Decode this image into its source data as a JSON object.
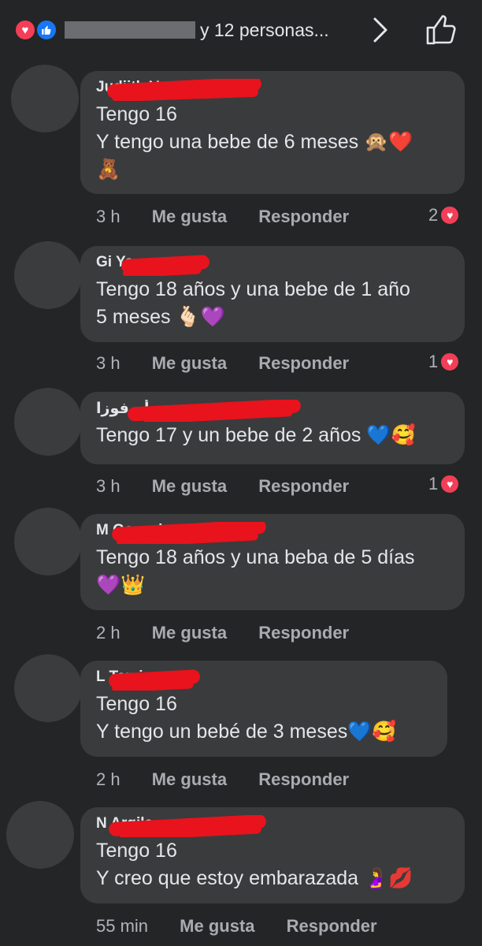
{
  "header": {
    "reactors_text": "y 12 personas...",
    "love_icon": "heart-icon",
    "like_icon": "thumbs-up-icon"
  },
  "comments": [
    {
      "author": "Judiith Vasquez",
      "lines": [
        "Tengo 16",
        "Y tengo una bebe de 6 meses 🙊❤️",
        "🧸"
      ],
      "time": "3 h",
      "like": "Me gusta",
      "reply": "Responder",
      "reactions": "2"
    },
    {
      "author": "Gi Ya",
      "lines": [
        "Tengo 18 años y una bebe de 1 año",
        "5 meses 🫰🏻💜"
      ],
      "time": "3 h",
      "like": "Me gusta",
      "reply": "Responder",
      "reactions": "1"
    },
    {
      "author": "أم فوزا",
      "lines": [
        "Tengo 17 y un bebe de 2 años 💙🥰"
      ],
      "time": "3 h",
      "like": "Me gusta",
      "reply": "Responder",
      "reactions": "1"
    },
    {
      "author": "M Gonzalez",
      "lines": [
        "Tengo 18 años y una beba de 5 días",
        "💜👑"
      ],
      "time": "2 h",
      "like": "Me gusta",
      "reply": "Responder",
      "reactions": ""
    },
    {
      "author": "L Tami",
      "lines": [
        "Tengo 16",
        "Y tengo un bebé de 3 meses💙🥰"
      ],
      "time": "2 h",
      "like": "Me gusta",
      "reply": "Responder",
      "reactions": ""
    },
    {
      "author": "N Argila",
      "lines": [
        "Tengo 16",
        "Y creo que estoy embarazada 🤰💋"
      ],
      "time": "55 min",
      "like": "Me gusta",
      "reply": "Responder",
      "reactions": ""
    }
  ]
}
